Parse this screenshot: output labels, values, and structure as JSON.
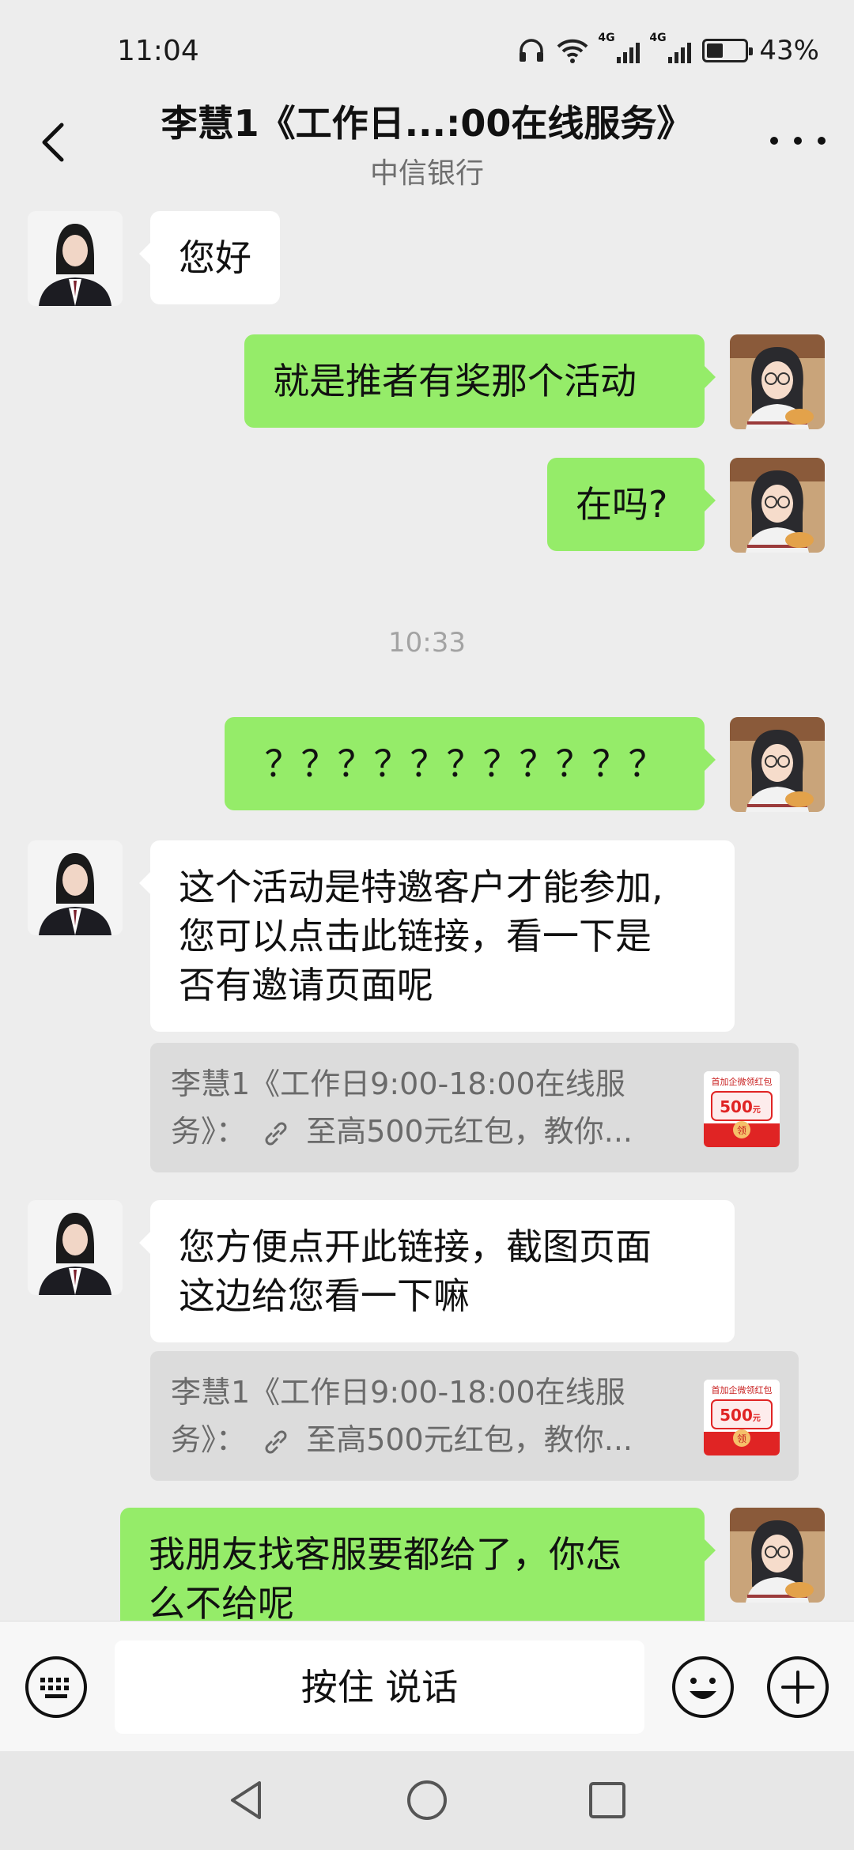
{
  "status": {
    "time": "11:04",
    "network_label": "4G",
    "battery_percent": "43%",
    "battery_level": 0.43
  },
  "header": {
    "title": "李慧1《工作日...:00在线服务》",
    "subtitle": "中信银行"
  },
  "messages": {
    "m1": "您好",
    "m2": "就是推者有奖那个活动",
    "m3": "在吗?",
    "time1": "10:33",
    "m4": "？？？？？？？？？？？",
    "m5_line1": "这个活动是特邀客户才能参加,",
    "m5_line2": "您可以点击此链接，看一下是",
    "m5_line3": "否有邀请页面呢",
    "q1_line1": "李慧1《工作日9:00-18:00在线服",
    "q1_prefix": "务》：",
    "q1_text": "至高500元红包，教你...",
    "m6_line1": "您方便点开此链接，截图页面",
    "m6_line2": "这边给您看一下嘛",
    "q2_line1": "李慧1《工作日9:00-18:00在线服",
    "q2_prefix": "务》：",
    "q2_text": "至高500元红包，教你...",
    "m7_line1": "我朋友找客服要都给了，你怎",
    "m7_line2": "么不给呢"
  },
  "thumb": {
    "top_text": "首加企微",
    "top_highlight": "领",
    "top_tail": "红包",
    "amount": "500",
    "unit": "元",
    "action": "领"
  },
  "input": {
    "hold_to_talk": "按住 说话"
  },
  "colors": {
    "outgoing": "#95ec69",
    "incoming": "#ffffff",
    "background": "#ededed",
    "red": "#e02424"
  }
}
